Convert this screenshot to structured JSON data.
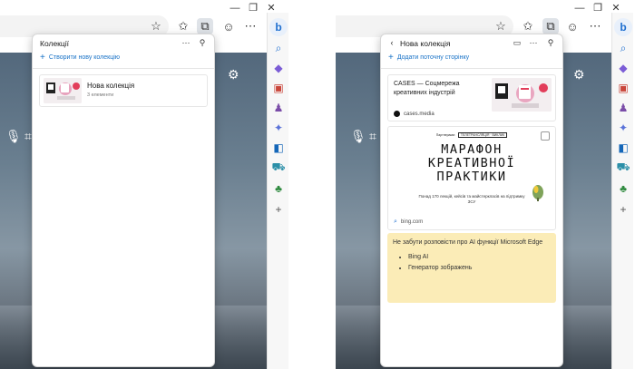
{
  "colors": {
    "accent": "#1a73c7",
    "note_bg": "#fbecb7",
    "sidebar_bg": "#f7f7f7",
    "panel_bg": "#ffffff"
  },
  "toolbar": {
    "icons": [
      "favorite-add-icon",
      "favorites-icon",
      "collections-icon",
      "profile-icon",
      "more-icon"
    ]
  },
  "sidebar": {
    "icons": [
      "bing-icon",
      "search-icon",
      "tag-icon",
      "toolbox-icon",
      "people-icon",
      "games-icon",
      "outlook-icon",
      "shopping-icon",
      "tree-icon",
      "add-icon"
    ],
    "bing_label": "b",
    "add_label": "+"
  },
  "left_panel": {
    "title": "Колекції",
    "create_label": "Створити нову колекцію",
    "collection": {
      "name": "Нова колекція",
      "count": "3 елементи"
    }
  },
  "right_panel": {
    "title": "Нова колекція",
    "add_label": "Додати поточну сторінку",
    "card1": {
      "title": "CASES — Соцмережа креативних індустрій",
      "source": "cases.media"
    },
    "card2": {
      "partner": "Партнерами:",
      "partner_logo": "ТЕЛЕТРАНСЛЯЦІЯ · ВИКЛИК",
      "big_line1": "МАРАФОН",
      "big_line2": "КРЕАТИВНОЇ",
      "big_line3": "ПРАКТИКИ",
      "sub": "Понад 170 лекцій, кейсів та майстеркласів на підтримку ЗСУ",
      "source": "bing.com"
    },
    "note": {
      "text": "Не забути розповісти про AI функції Microsoft Edge",
      "items": [
        "Bing AI",
        "Генератор зображень"
      ]
    }
  }
}
